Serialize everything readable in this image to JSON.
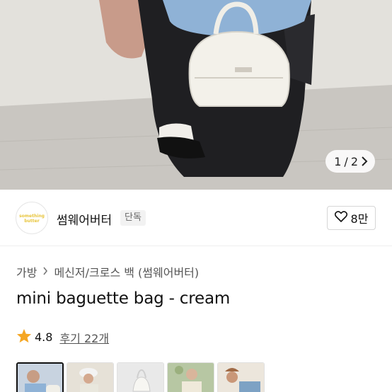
{
  "hero": {
    "current_page": "1",
    "separator": "/",
    "total_pages": "2",
    "next_icon": "chevron-right-icon"
  },
  "seller": {
    "logo_text": "something butter",
    "name": "썸웨어버터",
    "badge": "단독",
    "like_icon": "heart-outline-icon",
    "like_count": "8만"
  },
  "breadcrumb": {
    "level1": "가방",
    "level2": "메신저/크로스 백 (썸웨어버터)"
  },
  "product": {
    "title": "mini baguette bag - cream",
    "rating_icon": "star-icon",
    "rating": "4.8",
    "reviews": "후기 22개"
  },
  "thumbnails": 5,
  "colors": {
    "star": "#F5A623",
    "text": "#111111",
    "muted": "#555555"
  }
}
